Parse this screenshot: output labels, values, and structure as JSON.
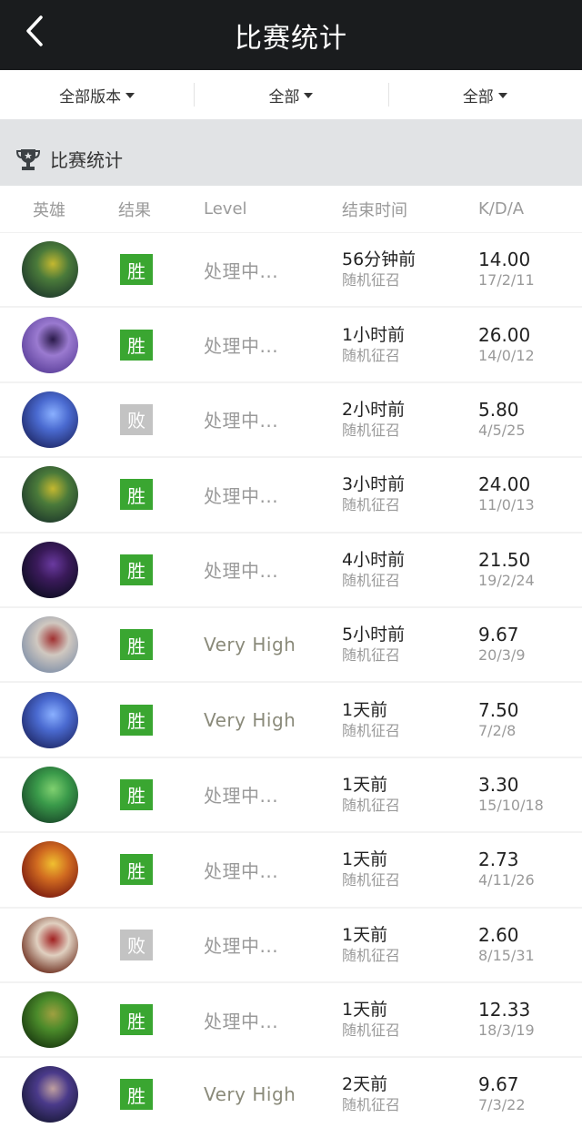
{
  "header": {
    "title": "比赛统计",
    "back_icon": "chevron-left-icon"
  },
  "filters": [
    {
      "label": "全部版本"
    },
    {
      "label": "全部"
    },
    {
      "label": "全部"
    }
  ],
  "section": {
    "title": "比赛统计",
    "icon": "trophy-icon"
  },
  "columns": {
    "hero": "英雄",
    "result": "结果",
    "level": "Level",
    "time": "结束时间",
    "kda": "K/D/A"
  },
  "colors": {
    "win": "#3aa631",
    "lose": "#c3c3c3",
    "topbar": "#1a1c1e",
    "section_bg": "#e1e3e5"
  },
  "matches": [
    {
      "hero_colors": [
        "#1f3a2c",
        "#4a7a3a",
        "#c4b830"
      ],
      "result": "胜",
      "win": true,
      "level": "处理中...",
      "time": "56分钟前",
      "mode": "随机征召",
      "kda_ratio": "14.00",
      "kda": "17/2/11"
    },
    {
      "hero_colors": [
        "#5b3f9a",
        "#9a7ad0",
        "#2a1a4a"
      ],
      "result": "胜",
      "win": true,
      "level": "处理中...",
      "time": "1小时前",
      "mode": "随机征召",
      "kda_ratio": "26.00",
      "kda": "14/0/12"
    },
    {
      "hero_colors": [
        "#202a6a",
        "#4a6ad0",
        "#8ab0ff"
      ],
      "result": "败",
      "win": false,
      "level": "处理中...",
      "time": "2小时前",
      "mode": "随机征召",
      "kda_ratio": "5.80",
      "kda": "4/5/25"
    },
    {
      "hero_colors": [
        "#1f3a2c",
        "#4a7a3a",
        "#c4b830"
      ],
      "result": "胜",
      "win": true,
      "level": "处理中...",
      "time": "3小时前",
      "mode": "随机征召",
      "kda_ratio": "24.00",
      "kda": "11/0/13"
    },
    {
      "hero_colors": [
        "#0e0e22",
        "#3a1a5a",
        "#6a3aa0"
      ],
      "result": "胜",
      "win": true,
      "level": "处理中...",
      "time": "4小时前",
      "mode": "随机征召",
      "kda_ratio": "21.50",
      "kda": "19/2/24"
    },
    {
      "hero_colors": [
        "#8090a8",
        "#d0c8c0",
        "#a03030"
      ],
      "result": "胜",
      "win": true,
      "level": "Very High",
      "time": "5小时前",
      "mode": "随机征召",
      "kda_ratio": "9.67",
      "kda": "20/3/9"
    },
    {
      "hero_colors": [
        "#202a6a",
        "#4a6ad0",
        "#8ab0ff"
      ],
      "result": "胜",
      "win": true,
      "level": "Very High",
      "time": "1天前",
      "mode": "随机征召",
      "kda_ratio": "7.50",
      "kda": "7/2/8"
    },
    {
      "hero_colors": [
        "#1a4a2a",
        "#3a9a4a",
        "#80d070"
      ],
      "result": "胜",
      "win": true,
      "level": "处理中...",
      "time": "1天前",
      "mode": "随机征召",
      "kda_ratio": "3.30",
      "kda": "15/10/18"
    },
    {
      "hero_colors": [
        "#7a1a10",
        "#d06a20",
        "#f0c030"
      ],
      "result": "胜",
      "win": true,
      "level": "处理中...",
      "time": "1天前",
      "mode": "随机征召",
      "kda_ratio": "2.73",
      "kda": "4/11/26"
    },
    {
      "hero_colors": [
        "#6a2a1a",
        "#e0d0c0",
        "#a02020"
      ],
      "result": "败",
      "win": false,
      "level": "处理中...",
      "time": "1天前",
      "mode": "随机征召",
      "kda_ratio": "2.60",
      "kda": "8/15/31"
    },
    {
      "hero_colors": [
        "#1a3a10",
        "#4a8a2a",
        "#a0a040"
      ],
      "result": "胜",
      "win": true,
      "level": "处理中...",
      "time": "1天前",
      "mode": "随机征召",
      "kda_ratio": "12.33",
      "kda": "18/3/19"
    },
    {
      "hero_colors": [
        "#1a1a3a",
        "#4a3a8a",
        "#c0a0a0"
      ],
      "result": "胜",
      "win": true,
      "level": "Very High",
      "time": "2天前",
      "mode": "随机征召",
      "kda_ratio": "9.67",
      "kda": "7/3/22"
    }
  ]
}
